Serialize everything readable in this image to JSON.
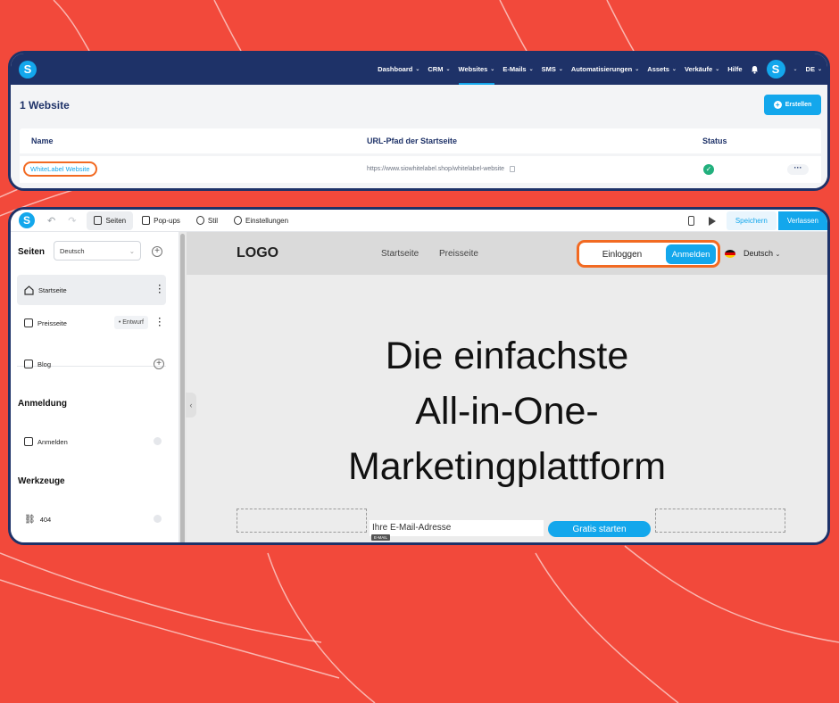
{
  "colors": {
    "background": "#f2493b",
    "brand": "#1e3268",
    "accent": "#13a7ec",
    "highlight": "#f26a22",
    "success": "#22b07d"
  },
  "nav": {
    "logo_letter": "S",
    "items": [
      {
        "label": "Dashboard",
        "chevron": true
      },
      {
        "label": "CRM",
        "chevron": true
      },
      {
        "label": "Websites",
        "chevron": true,
        "active": true
      },
      {
        "label": "E-Mails",
        "chevron": true
      },
      {
        "label": "SMS",
        "chevron": true
      },
      {
        "label": "Automatisierungen",
        "chevron": true
      },
      {
        "label": "Assets",
        "chevron": true
      },
      {
        "label": "Verkäufe",
        "chevron": true
      },
      {
        "label": "Hilfe",
        "chevron": false
      }
    ],
    "avatar_letter": "S",
    "language": "DE"
  },
  "websites": {
    "title": "1 Website",
    "create_label": "Erstellen",
    "columns": [
      "Name",
      "URL-Pfad der Startseite",
      "Status"
    ],
    "rows": [
      {
        "name": "WhiteLabel Website",
        "url": "https://www.siowhitelabel.shop/whitelabel-website",
        "status": "ok"
      }
    ]
  },
  "editor": {
    "logo_letter": "S",
    "tabs": [
      "Seiten",
      "Pop-ups",
      "Stil",
      "Einstellungen"
    ],
    "save_label": "Speichern",
    "exit_label": "Verlassen"
  },
  "sidebar": {
    "pages_heading": "Seiten",
    "language": "Deutsch",
    "pages": [
      {
        "label": "Startseite"
      },
      {
        "label": "Preisseite",
        "badge": "• Entwurf"
      }
    ],
    "blog": "Blog",
    "auth_heading": "Anmeldung",
    "auth_item": "Anmelden",
    "tools_heading": "Werkzeuge",
    "tools_item": "404"
  },
  "preview": {
    "logo": "LOGO",
    "nav": [
      "Startseite",
      "Preisseite"
    ],
    "login": "Einloggen",
    "register": "Anmelden",
    "language": "Deutsch",
    "hero": [
      "Die einfachste",
      "All-in-One-",
      "Marketingplattform"
    ],
    "email_placeholder": "Ihre E-Mail-Adresse",
    "email_label": "E-MAIL",
    "cta": "Gratis starten"
  }
}
